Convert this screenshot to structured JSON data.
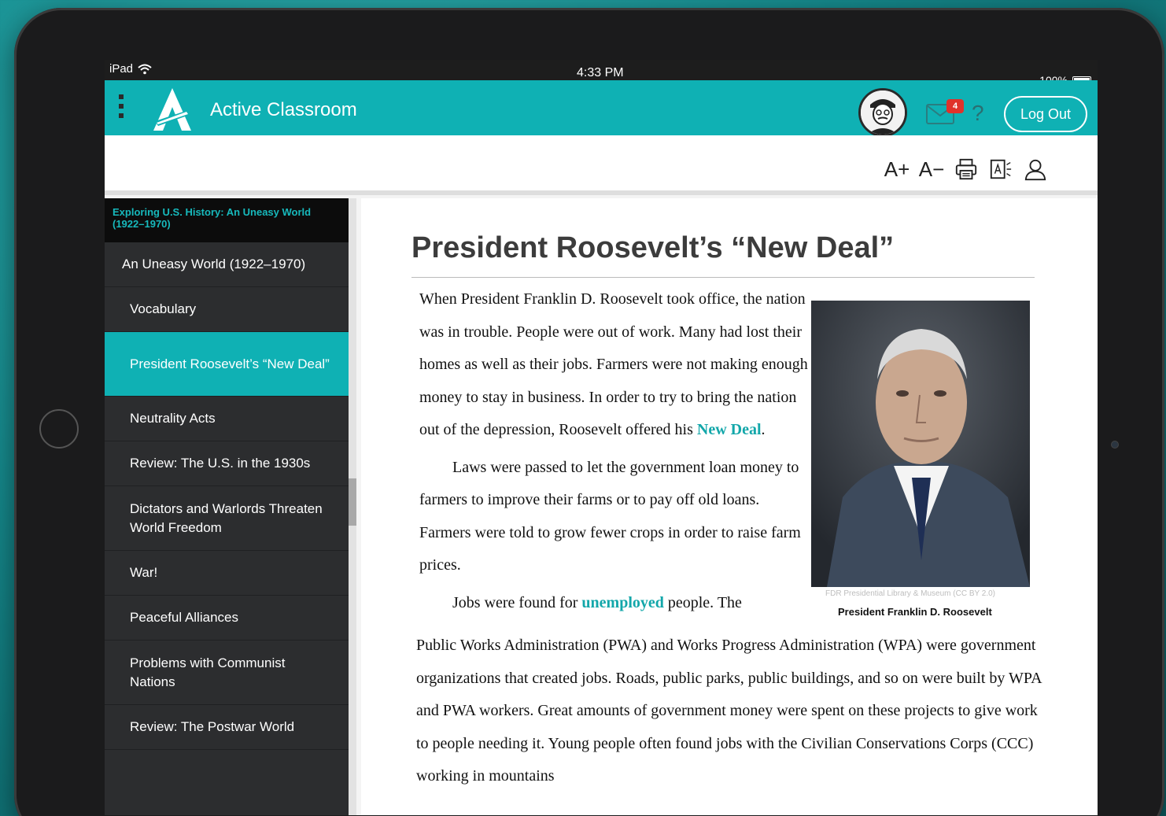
{
  "status_bar": {
    "device": "iPad",
    "time": "4:33 PM",
    "battery": "100%"
  },
  "app": {
    "title": "Active Classroom",
    "mail_count": "4",
    "help": "?",
    "logout_label": "Log Out",
    "accent_color": "#0fb1b4"
  },
  "toolbar": {
    "increase_font": "A+",
    "decrease_font": "A−",
    "print_icon": "printer-icon",
    "read_aloud_icon": "read-aloud-icon",
    "profile_icon": "user-icon"
  },
  "sidebar": {
    "book_title": "Exploring U.S. History: An Uneasy World (1922–1970)",
    "items": [
      {
        "label": "An Uneasy World (1922–1970)"
      },
      {
        "label": "Vocabulary"
      },
      {
        "label": "President Roosevelt’s “New Deal”"
      },
      {
        "label": "Neutrality Acts"
      },
      {
        "label": "Review: The U.S. in the 1930s"
      },
      {
        "label": "Dictators and Warlords Threaten World Freedom"
      },
      {
        "label": "War!"
      },
      {
        "label": "Peaceful Alliances"
      },
      {
        "label": "Problems with Communist Nations"
      },
      {
        "label": "Review: The Postwar World"
      }
    ]
  },
  "article": {
    "title": "President Roosevelt’s “New Deal”",
    "p1_before": "When President Franklin D. Roosevelt took office, the nation was in trouble. People were out of work. Many had lost their homes as well as their jobs. Farmers were not making enough money to stay in business. In order to try to bring the nation out of the depression, Roosevelt offered his ",
    "p1_link": "New Deal",
    "p1_after": ".",
    "p2": "Laws were passed to let the government loan money to farmers to improve their farms or to pay off old loans. Farmers were told to grow fewer crops in order to raise farm prices.",
    "p3_before": "Jobs were found for ",
    "p3_link": "unemployed",
    "p3_after": " people. The",
    "p3_cont": "Public Works Administration (PWA) and Works Progress Administration (WPA) were government organizations that created jobs. Roads, public parks, public buildings, and so on were built by WPA and PWA workers. Great amounts of government money were spent on these projects to give work to people needing it. Young people often found jobs with the Civilian Conservations Corps (CCC) working in mountains",
    "image_credit": "FDR Presidential Library & Museum (CC BY 2.0)",
    "image_caption": "President Franklin D. Roosevelt"
  }
}
